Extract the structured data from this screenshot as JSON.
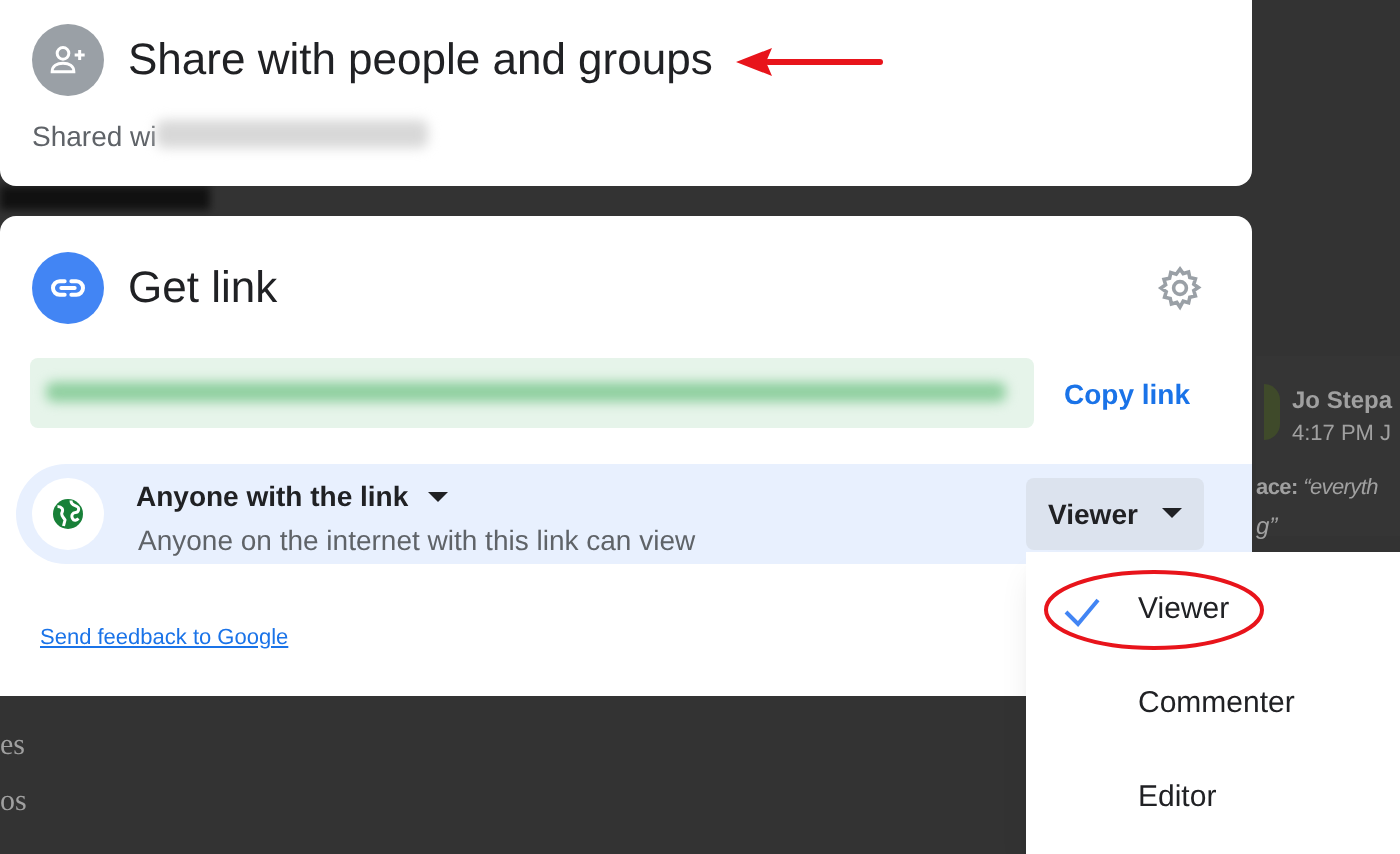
{
  "share_dialog": {
    "title": "Share with people and groups",
    "shared_with": "Shared wi"
  },
  "link_dialog": {
    "title": "Get link",
    "copy_link": "Copy link",
    "access": {
      "scope": "Anyone with the link",
      "description": "Anyone on the internet with this link can view",
      "role": "Viewer"
    },
    "feedback_link": "Send feedback to Google"
  },
  "role_menu": {
    "items": [
      {
        "label": "Viewer",
        "selected": true
      },
      {
        "label": "Commenter",
        "selected": false
      },
      {
        "label": "Editor",
        "selected": false
      }
    ]
  },
  "background": {
    "comment": {
      "author": "Jo Stepa",
      "time": "4:17 PM J",
      "text": "**ace:** *“everyth*",
      "text_2": "*g”*"
    },
    "doc_lines": [
      "es",
      "os"
    ]
  }
}
